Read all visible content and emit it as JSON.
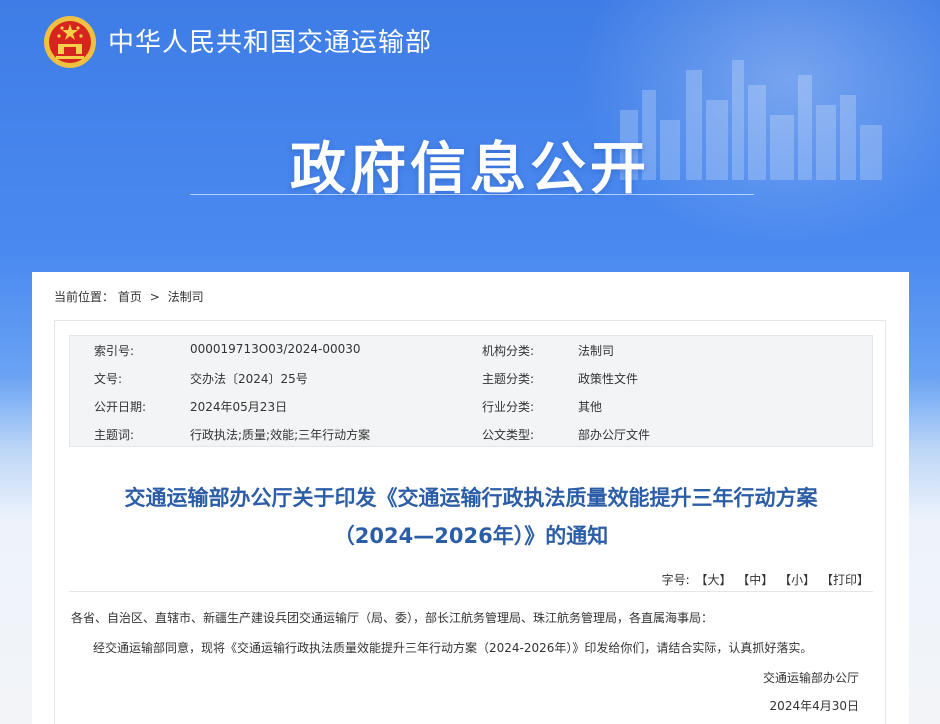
{
  "colors": {
    "banner_blue": "#4a8af0",
    "title_blue": "#2c5ea8",
    "meta_bg": "#f3f4f6"
  },
  "header": {
    "emblem_icon": "national-emblem-icon",
    "site_title": "中华人民共和国交通运输部",
    "banner_title": "政府信息公开"
  },
  "breadcrumb": {
    "label": "当前位置：",
    "home": "首页",
    "separator": ">",
    "current": "法制司"
  },
  "meta": {
    "rows": [
      {
        "k1": "索引号:",
        "v1": "000019713O03/2024-00030",
        "k2": "机构分类:",
        "v2": "法制司"
      },
      {
        "k1": "文号:",
        "v1": "交办法〔2024〕25号",
        "k2": "主题分类:",
        "v2": "政策性文件"
      },
      {
        "k1": "公开日期:",
        "v1": "2024年05月23日",
        "k2": "行业分类:",
        "v2": "其他"
      },
      {
        "k1": "主题词:",
        "v1": "行政执法;质量;效能;三年行动方案",
        "k2": "公文类型:",
        "v2": "部办公厅文件"
      }
    ]
  },
  "document": {
    "title_line1": "交通运输部办公厅关于印发《交通运输行政执法质量效能提升三年行动方案",
    "title_line2": "（2024—2026年）》的通知",
    "font_label": "字号:",
    "font_large": "【大】",
    "font_medium": "【中】",
    "font_small": "【小】",
    "print": "【打印】",
    "recipients": "各省、自治区、直辖市、新疆生产建设兵团交通运输厅（局、委），部长江航务管理局、珠江航务管理局，各直属海事局：",
    "paragraph": "经交通运输部同意，现将《交通运输行政执法质量效能提升三年行动方案（2024-2026年）》印发给你们，请结合实际，认真抓好落实。",
    "signature": "交通运输部办公厅",
    "date": "2024年4月30日"
  }
}
